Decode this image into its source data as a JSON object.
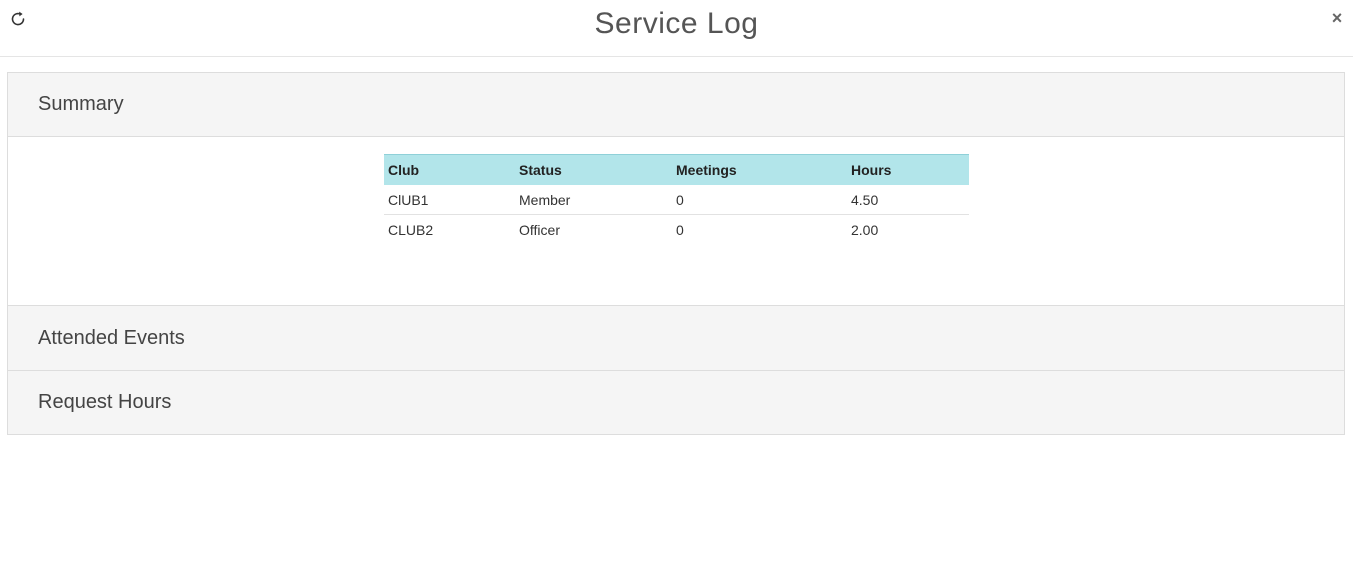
{
  "header": {
    "title": "Service Log",
    "refresh_icon": "refresh-icon",
    "close_label": "×"
  },
  "panels": [
    {
      "label": "Summary"
    },
    {
      "label": "Attended Events"
    },
    {
      "label": "Request Hours"
    }
  ],
  "summary_table": {
    "columns": [
      "Club",
      "Status",
      "Meetings",
      "Hours"
    ],
    "rows": [
      {
        "club": "ClUB1",
        "status": "Member",
        "meetings": "0",
        "hours": "4.50"
      },
      {
        "club": "CLUB2",
        "status": "Officer",
        "meetings": "0",
        "hours": "2.00"
      }
    ]
  },
  "colors": {
    "table_header_bg": "#b2e5ea",
    "panel_header_bg": "#f5f5f5"
  }
}
